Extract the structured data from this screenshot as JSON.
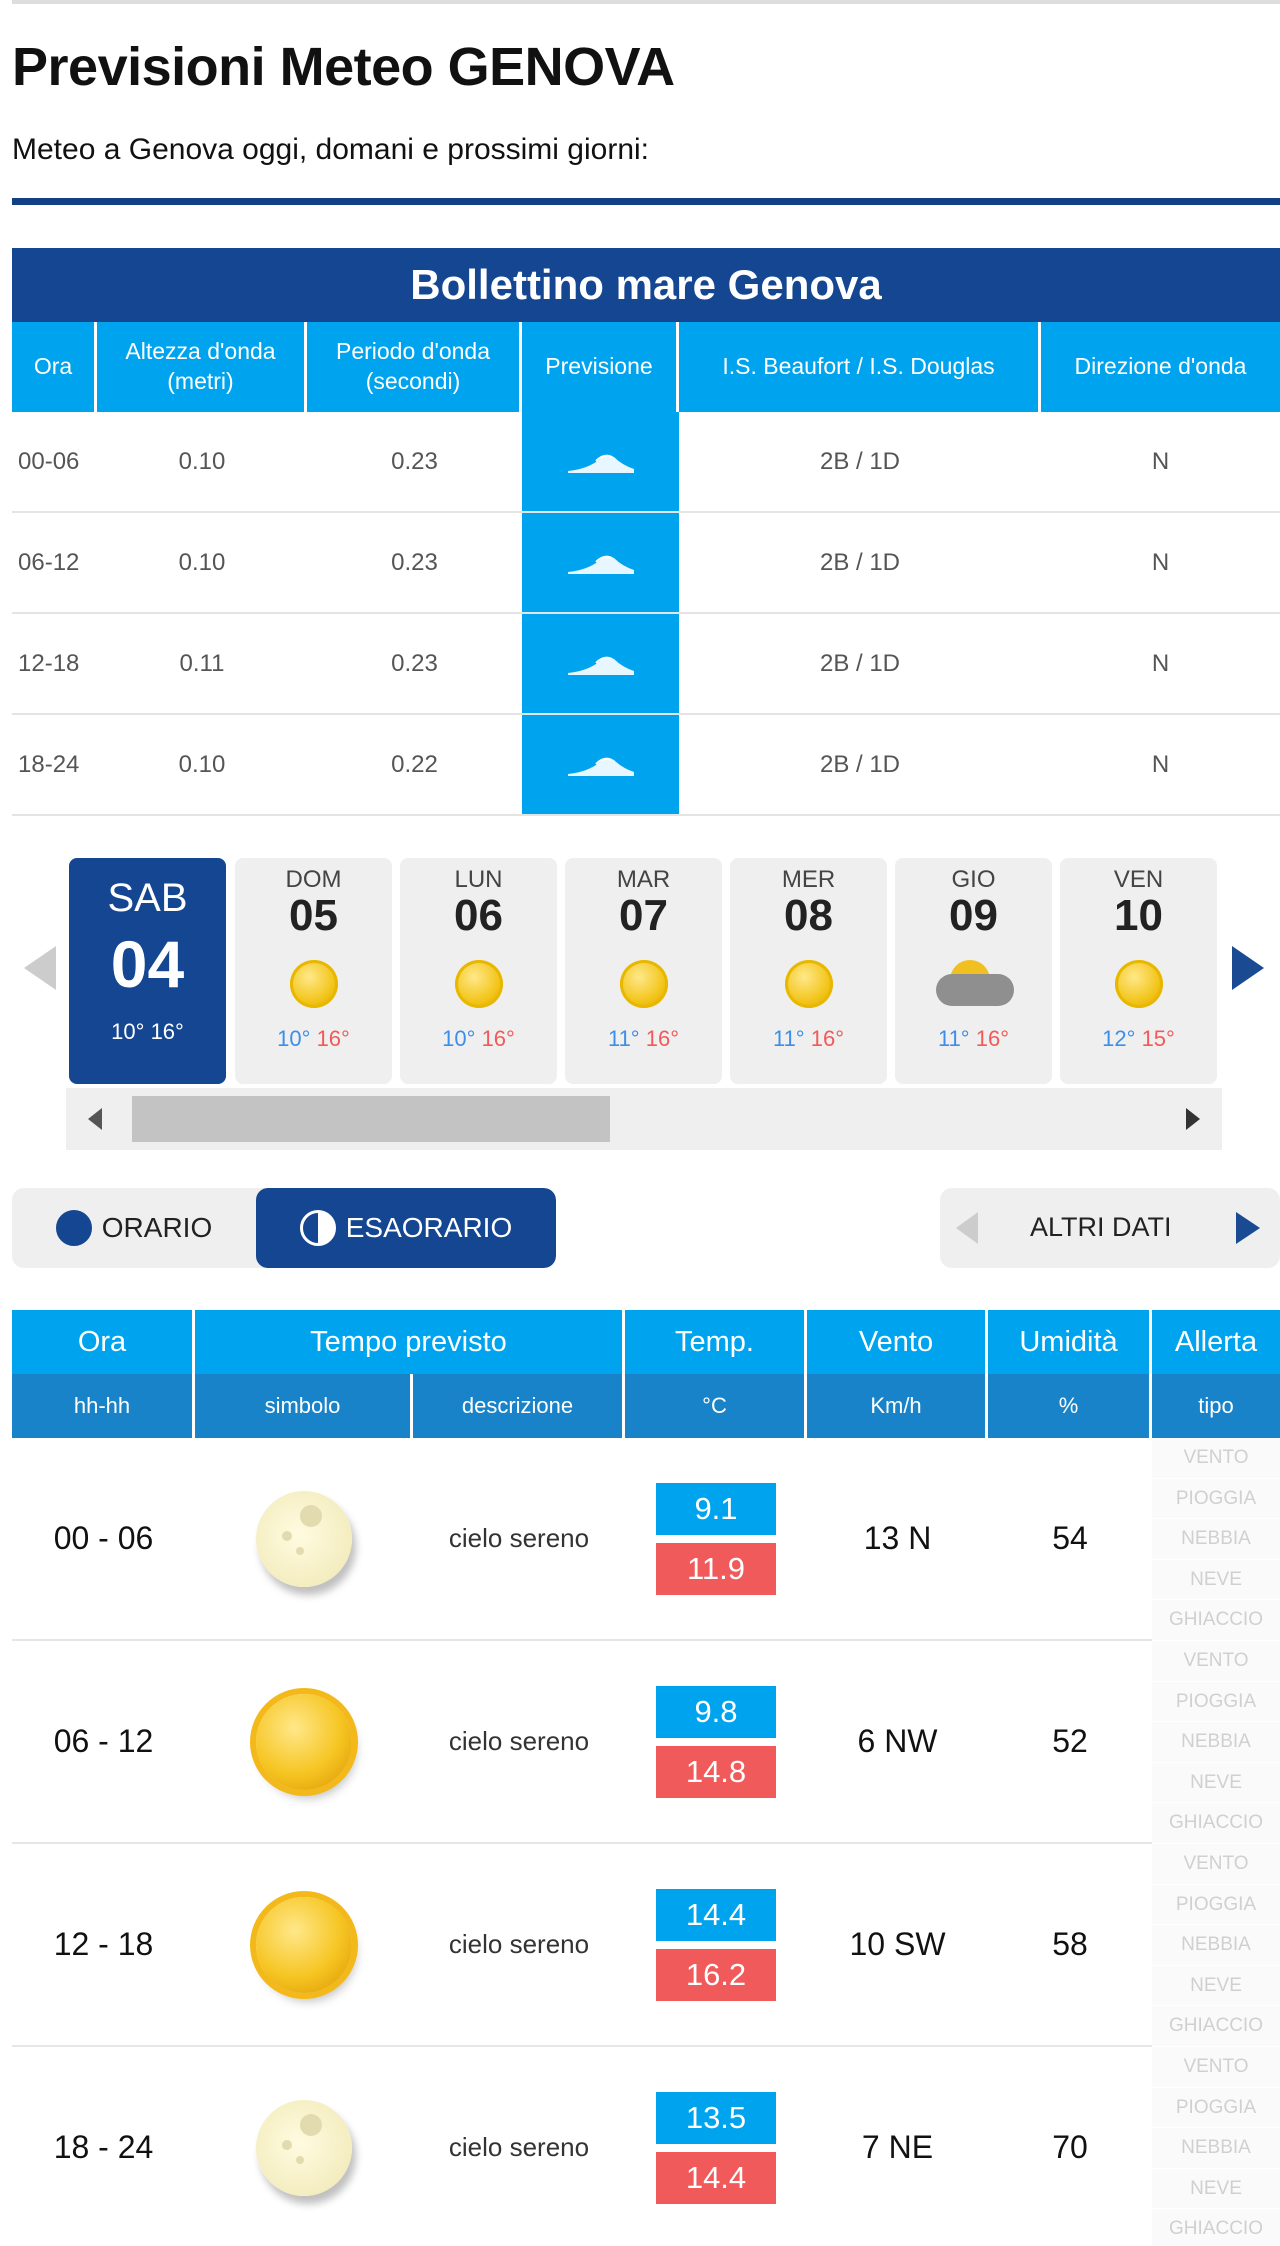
{
  "page": {
    "title": "Previsioni Meteo GENOVA",
    "subtitle": "Meteo a Genova oggi, domani e prossimi giorni:"
  },
  "sea": {
    "title": "Bollettino mare Genova",
    "headers": [
      "Ora",
      "Altezza d'onda\n(metri)",
      "Periodo d'onda\n(secondi)",
      "Previsione",
      "I.S. Beaufort / I.S. Douglas",
      "Direzione d'onda"
    ],
    "rows": [
      {
        "ora": "00-06",
        "altezza": "0.10",
        "periodo": "0.23",
        "scala": "2B / 1D",
        "direzione": "N"
      },
      {
        "ora": "06-12",
        "altezza": "0.10",
        "periodo": "0.23",
        "scala": "2B / 1D",
        "direzione": "N"
      },
      {
        "ora": "12-18",
        "altezza": "0.11",
        "periodo": "0.23",
        "scala": "2B / 1D",
        "direzione": "N"
      },
      {
        "ora": "18-24",
        "altezza": "0.10",
        "periodo": "0.22",
        "scala": "2B / 1D",
        "direzione": "N"
      }
    ]
  },
  "days": [
    {
      "name": "SAB",
      "num": "04",
      "min": "10°",
      "max": "16°",
      "icon": "sun-icon",
      "active": true
    },
    {
      "name": "DOM",
      "num": "05",
      "min": "10°",
      "max": "16°",
      "icon": "sun-icon"
    },
    {
      "name": "LUN",
      "num": "06",
      "min": "10°",
      "max": "16°",
      "icon": "sun-icon"
    },
    {
      "name": "MAR",
      "num": "07",
      "min": "11°",
      "max": "16°",
      "icon": "sun-icon"
    },
    {
      "name": "MER",
      "num": "08",
      "min": "11°",
      "max": "16°",
      "icon": "sun-icon"
    },
    {
      "name": "GIO",
      "num": "09",
      "min": "11°",
      "max": "16°",
      "icon": "cloud-sun-icon"
    },
    {
      "name": "VEN",
      "num": "10",
      "min": "12°",
      "max": "15°",
      "icon": "sun-icon"
    }
  ],
  "toggle": {
    "orario": "ORARIO",
    "esaorario": "ESAORARIO"
  },
  "altri": "ALTRI DATI",
  "forecast": {
    "head1": [
      "Ora",
      "Tempo previsto",
      "Temp.",
      "Vento",
      "Umidità",
      "Allerta"
    ],
    "head2": [
      "hh-hh",
      "simbolo",
      "descrizione",
      "°C",
      "Km/h",
      "%",
      "tipo"
    ],
    "alerts": [
      "VENTO",
      "PIOGGIA",
      "NEBBIA",
      "NEVE",
      "GHIACCIO"
    ],
    "rows": [
      {
        "ora": "00 - 06",
        "icon": "moon-icon",
        "desc": "cielo sereno",
        "tmin": "9.1",
        "tmax": "11.9",
        "vento": "13 N",
        "umidita": "54"
      },
      {
        "ora": "06 - 12",
        "icon": "sun-icon",
        "desc": "cielo sereno",
        "tmin": "9.8",
        "tmax": "14.8",
        "vento": "6 NW",
        "umidita": "52"
      },
      {
        "ora": "12 - 18",
        "icon": "sun-icon",
        "desc": "cielo sereno",
        "tmin": "14.4",
        "tmax": "16.2",
        "vento": "10 SW",
        "umidita": "58"
      },
      {
        "ora": "18 - 24",
        "icon": "moon-icon",
        "desc": "cielo sereno",
        "tmin": "13.5",
        "tmax": "14.4",
        "vento": "7 NE",
        "umidita": "70"
      }
    ]
  },
  "colors": {
    "navy": "#144692",
    "cyan": "#00a4ee",
    "red": "#f05a5a"
  }
}
